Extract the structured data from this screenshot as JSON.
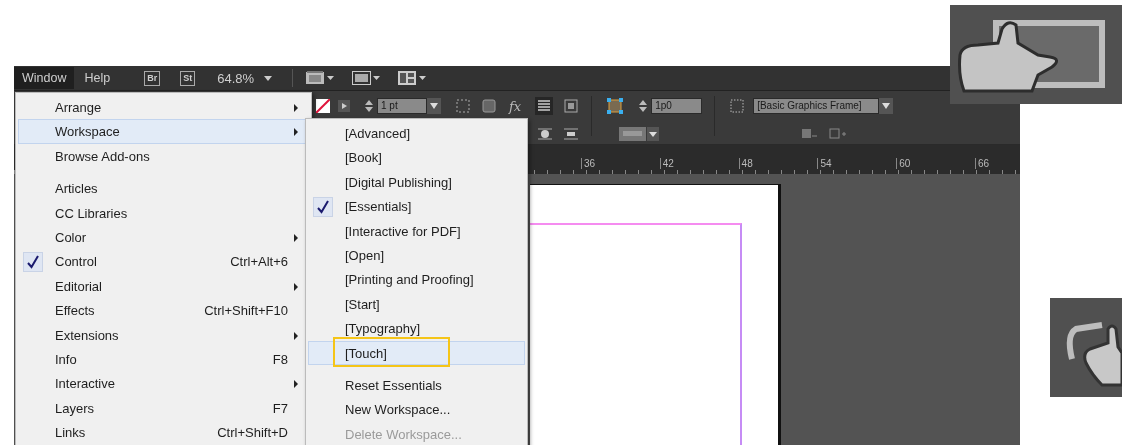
{
  "menu_bar": {
    "items": [
      {
        "label": "Window",
        "selected": true
      },
      {
        "label": "Help",
        "selected": false
      }
    ],
    "badges": [
      "Br",
      "St"
    ],
    "zoom": "64.8%"
  },
  "control_panel": {
    "stroke_weight": "1 pt",
    "effects": "fx",
    "offset": "1p0",
    "object_style": "[Basic Graphics Frame]"
  },
  "ruler": {
    "labels": [
      "36",
      "42",
      "48",
      "54",
      "60",
      "66"
    ]
  },
  "window_menu": {
    "sections": [
      [
        {
          "label": "Arrange",
          "submenu": true,
          "checked": false,
          "selected": false
        },
        {
          "label": "Workspace",
          "submenu": true,
          "checked": false,
          "selected": true
        },
        {
          "label": "Browse Add-ons",
          "submenu": false,
          "checked": false,
          "selected": false
        }
      ],
      [
        {
          "label": "Articles",
          "submenu": false,
          "checked": false,
          "selected": false
        },
        {
          "label": "CC Libraries",
          "submenu": false,
          "checked": false,
          "selected": false
        },
        {
          "label": "Color",
          "submenu": true,
          "checked": false,
          "selected": false
        },
        {
          "label": "Control",
          "shortcut": "Ctrl+Alt+6",
          "submenu": false,
          "checked": true,
          "selected": false
        },
        {
          "label": "Editorial",
          "submenu": true,
          "checked": false,
          "selected": false
        },
        {
          "label": "Effects",
          "shortcut": "Ctrl+Shift+F10",
          "submenu": false,
          "checked": false,
          "selected": false
        },
        {
          "label": "Extensions",
          "submenu": true,
          "checked": false,
          "selected": false
        },
        {
          "label": "Info",
          "shortcut": "F8",
          "submenu": false,
          "checked": false,
          "selected": false
        },
        {
          "label": "Interactive",
          "submenu": true,
          "checked": false,
          "selected": false
        },
        {
          "label": "Layers",
          "shortcut": "F7",
          "submenu": false,
          "checked": false,
          "selected": false
        },
        {
          "label": "Links",
          "shortcut": "Ctrl+Shift+D",
          "submenu": false,
          "checked": false,
          "selected": false
        }
      ]
    ]
  },
  "workspace_menu": {
    "sections": [
      [
        {
          "label": "[Advanced]",
          "checked": false,
          "selected": false,
          "highlighted": false,
          "disabled": false
        },
        {
          "label": "[Book]",
          "checked": false,
          "selected": false,
          "highlighted": false,
          "disabled": false
        },
        {
          "label": "[Digital Publishing]",
          "checked": false,
          "selected": false,
          "highlighted": false,
          "disabled": false
        },
        {
          "label": "[Essentials]",
          "checked": true,
          "selected": false,
          "highlighted": false,
          "disabled": false
        },
        {
          "label": "[Interactive for PDF]",
          "checked": false,
          "selected": false,
          "highlighted": false,
          "disabled": false
        },
        {
          "label": "[Open]",
          "checked": false,
          "selected": false,
          "highlighted": false,
          "disabled": false
        },
        {
          "label": "[Printing and Proofing]",
          "checked": false,
          "selected": false,
          "highlighted": false,
          "disabled": false
        },
        {
          "label": "[Start]",
          "checked": false,
          "selected": false,
          "highlighted": false,
          "disabled": false
        },
        {
          "label": "[Typography]",
          "checked": false,
          "selected": false,
          "highlighted": false,
          "disabled": false
        },
        {
          "label": "[Touch]",
          "checked": false,
          "selected": true,
          "highlighted": true,
          "disabled": false
        }
      ],
      [
        {
          "label": "Reset Essentials",
          "checked": false,
          "selected": false,
          "highlighted": false,
          "disabled": false
        },
        {
          "label": "New Workspace...",
          "checked": false,
          "selected": false,
          "highlighted": false,
          "disabled": false
        },
        {
          "label": "Delete Workspace...",
          "checked": false,
          "selected": false,
          "highlighted": false,
          "disabled": true
        }
      ]
    ]
  }
}
